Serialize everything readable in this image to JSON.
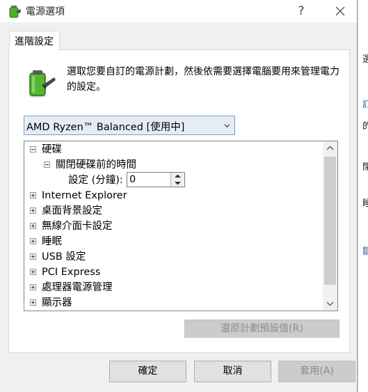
{
  "window": {
    "title": "電源選項",
    "help_label": "?",
    "close_label": "✕"
  },
  "tab": {
    "label": "進階設定"
  },
  "description": "選取您要自訂的電源計劃，然後依需要選擇電腦要用來管理電力的設定。",
  "plan_select": {
    "value": "AMD Ryzen™ Balanced [使用中]"
  },
  "tree": {
    "items": [
      {
        "label": "硬碟",
        "expanded": true
      },
      {
        "label": "關閉硬碟前的時間",
        "expanded": true
      },
      {
        "label": "設定 (分鐘):",
        "value": "0"
      },
      {
        "label": "Internet Explorer"
      },
      {
        "label": "桌面背景設定"
      },
      {
        "label": "無線介面卡設定"
      },
      {
        "label": "睡眠"
      },
      {
        "label": "USB 設定"
      },
      {
        "label": "PCI Express"
      },
      {
        "label": "處理器電源管理"
      },
      {
        "label": "顯示器"
      }
    ]
  },
  "restore_button": {
    "label": "還原計劃預設值(R)"
  },
  "buttons": {
    "ok": "確定",
    "cancel": "取消",
    "apply": "套用(A)"
  },
  "background_fragments": [
    "選",
    "訂",
    "的",
    "閉",
    "睡",
    "鄒"
  ]
}
